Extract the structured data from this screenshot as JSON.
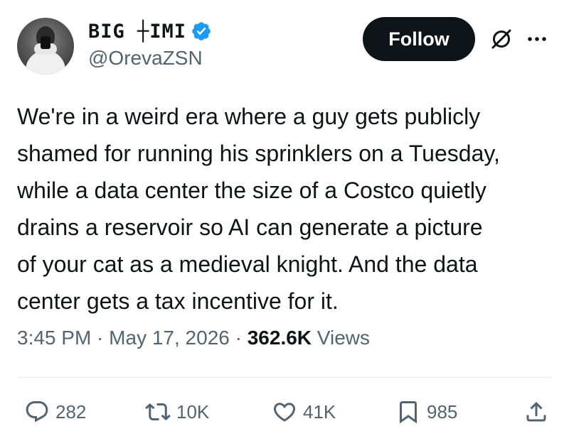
{
  "author": {
    "display_name": "BIG ┼IMI",
    "handle": "@OrevaZSN",
    "verified": true
  },
  "header": {
    "follow_label": "Follow",
    "icons": [
      "grok-icon",
      "more-icon"
    ]
  },
  "tweet": {
    "lines": [
      "We're in a weird era where a guy gets publicly",
      "shamed for running his sprinklers on a Tuesday,",
      "while a data center the size of a Costco quietly",
      "drains a reservoir so AI can generate a picture",
      "of your cat as a medieval knight. And the data",
      "center gets a tax incentive for it."
    ]
  },
  "meta": {
    "time": "3:45 PM",
    "sep1": " · ",
    "date": "May 17, 2026",
    "sep2": " · ",
    "views_count": "362.6K",
    "views_label": " Views"
  },
  "actions": {
    "replies": "282",
    "reposts": "10K",
    "likes": "41K",
    "bookmarks": "985"
  },
  "colors": {
    "text": "#0f1419",
    "secondary": "#536471",
    "verified": "#1d9bf0",
    "follow_bg": "#0f1419"
  }
}
